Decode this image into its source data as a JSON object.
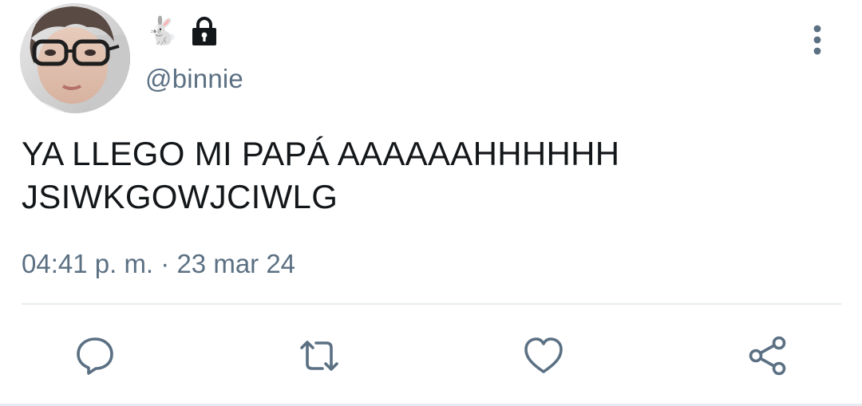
{
  "user": {
    "name_emoji": "🐇",
    "lock_icon": "lock-icon",
    "handle": "@binnie",
    "avatar": "profile-photo"
  },
  "tweet": {
    "lines": [
      "YA LLEGO MI PAPÁ AAAAAAHHHHHH",
      "JSIWKGOWJCIWLG"
    ],
    "time": "04:41 p. m.",
    "separator": "·",
    "date": "23 mar 24"
  },
  "actions": {
    "icons": [
      "reply-icon",
      "retweet-icon",
      "like-icon",
      "share-icon"
    ]
  },
  "menu": {
    "icon": "more-vertical-icon"
  },
  "colors": {
    "text_primary": "#14171a",
    "text_secondary": "#5b7083",
    "icon": "#5b7083",
    "divider": "#e6ecf0"
  }
}
